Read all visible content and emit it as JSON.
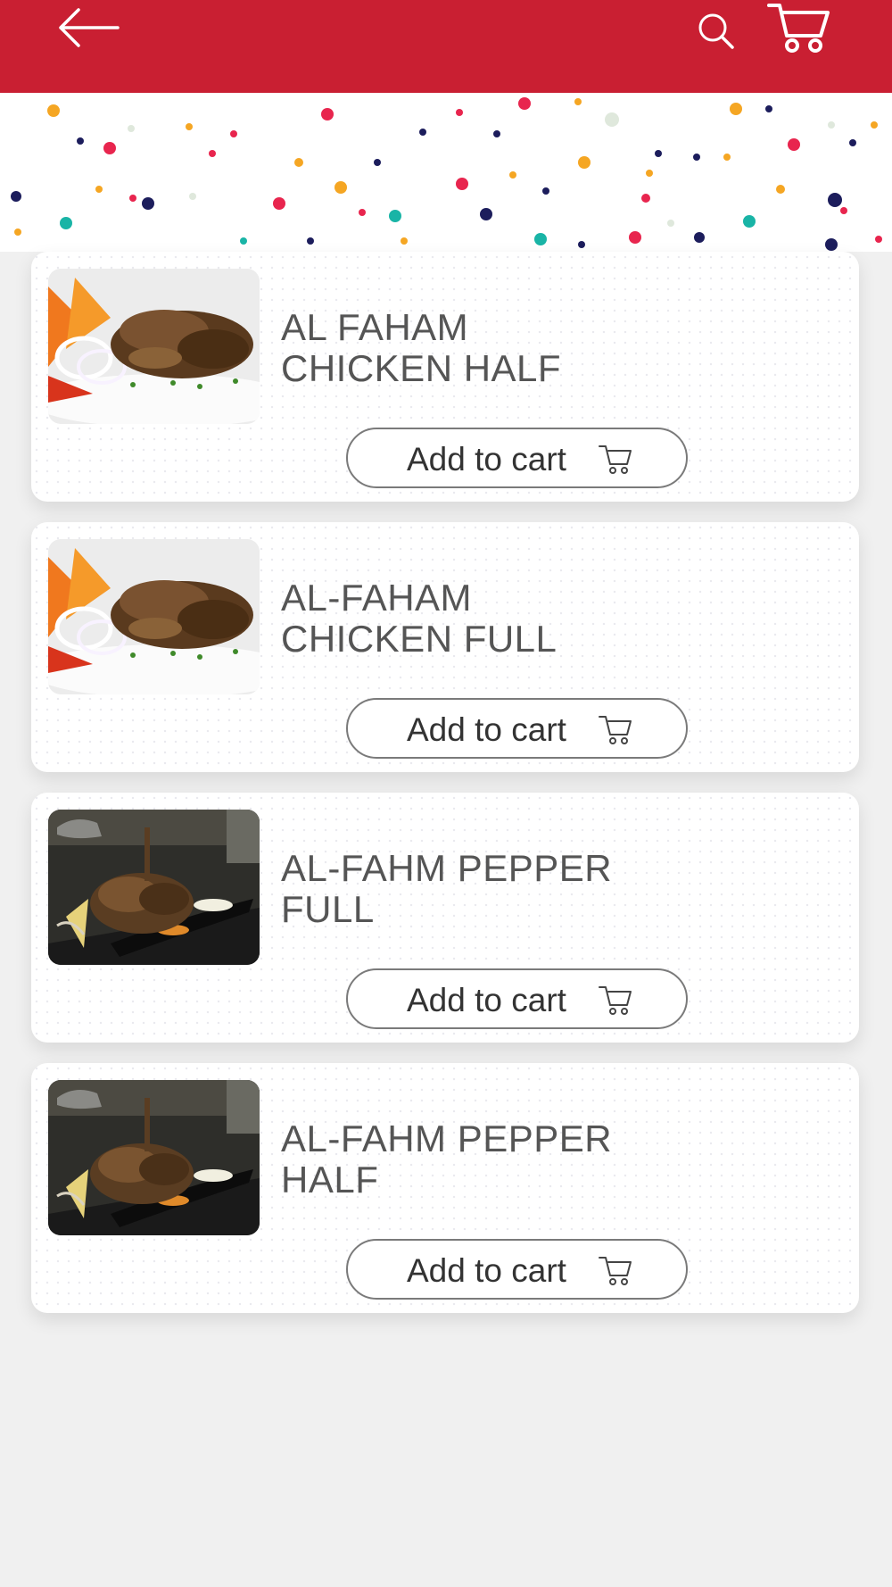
{
  "header": {
    "back_icon": "arrow-left-icon",
    "search_icon": "search-icon",
    "cart_icon": "cart-icon",
    "color": "#c91f32"
  },
  "products": [
    {
      "title": "AL FAHAM\nCHICKEN HALF",
      "image": "grilled-chicken-plate",
      "button_label": "Add to cart"
    },
    {
      "title": "AL-FAHAM\nCHICKEN FULL",
      "image": "grilled-chicken-plate",
      "button_label": "Add to cart"
    },
    {
      "title": "AL-FAHM PEPPER\nFULL",
      "image": "pepper-chicken-dark-plate",
      "button_label": "Add to cart"
    },
    {
      "title": "AL-FAHM PEPPER\nHALF",
      "image": "pepper-chicken-dark-plate",
      "button_label": "Add to cart"
    }
  ]
}
